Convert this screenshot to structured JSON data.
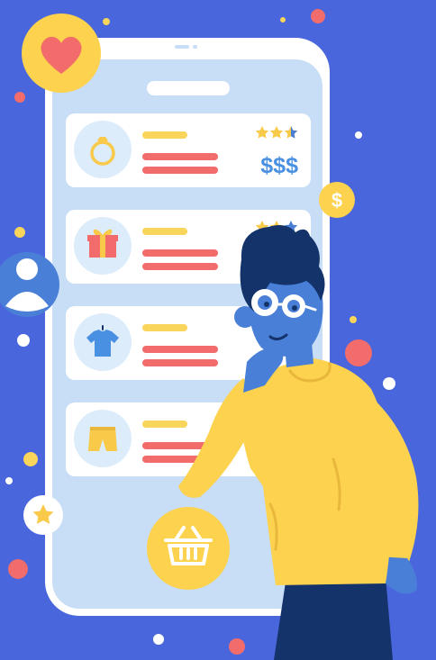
{
  "colors": {
    "background": "#4a66dc",
    "phone_frame": "#ffffff",
    "phone_screen": "#c8def7",
    "card": "#ffffff",
    "icon_circle": "#dcecfb",
    "accent_yellow": "#f9d55b",
    "accent_coral": "#f26c6c",
    "dollar_blue": "#4a90e2",
    "star_yellow": "#f9c94a",
    "star_blue": "#4a7fd8",
    "sweater": "#fcd24e",
    "skin": "#4a7fd8",
    "hair": "#14336b",
    "pants": "#14336b"
  },
  "cards": [
    {
      "icon": "ring-icon",
      "rating": "★★★",
      "price": "$$$"
    },
    {
      "icon": "gift-icon",
      "rating": "★★★"
    },
    {
      "icon": "tshirt-icon"
    },
    {
      "icon": "shorts-icon"
    }
  ],
  "floating": {
    "heart_badge": "heart-icon",
    "dollar_badge": "$",
    "avatar_badge": "user-icon",
    "star_badge": "star-icon",
    "basket_button": "basket-icon"
  }
}
